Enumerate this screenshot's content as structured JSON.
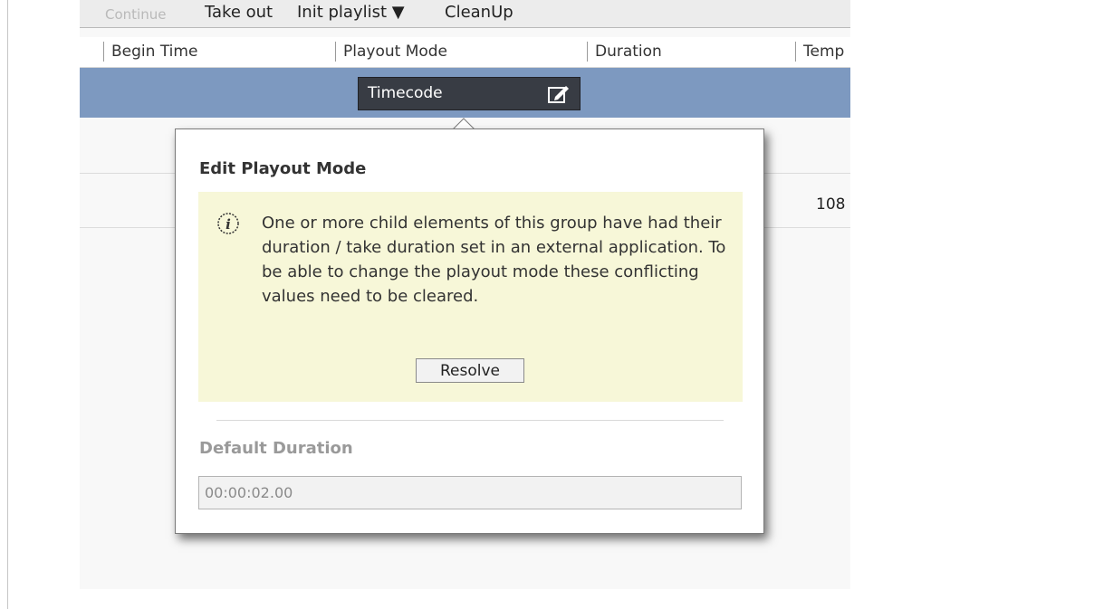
{
  "toolbar": {
    "continue_label": "Continue",
    "take_out_label": "Take out",
    "init_playlist_label": "Init playlist ▼",
    "cleanup_label": "CleanUp"
  },
  "columns": [
    "Begin Time",
    "Playout Mode",
    "Duration",
    "Temp"
  ],
  "selected_row": {
    "playout_mode": "Timecode",
    "edit_icon": "edit-icon"
  },
  "rows": [
    {
      "value": "108"
    }
  ],
  "popup": {
    "title": "Edit Playout Mode",
    "info_icon": "info-icon",
    "warning_text": "One or more child elements of this group have had their duration / take duration set in an external application. To be able to change the playout mode these conflicting values need to be cleared.",
    "resolve_label": "Resolve",
    "default_duration_label": "Default Duration",
    "default_duration_value": "00:00:02.00"
  },
  "colors": {
    "selection_row": "#7d99c0",
    "timecode_box": "#383c44",
    "warning_background": "#f7f7d8"
  }
}
